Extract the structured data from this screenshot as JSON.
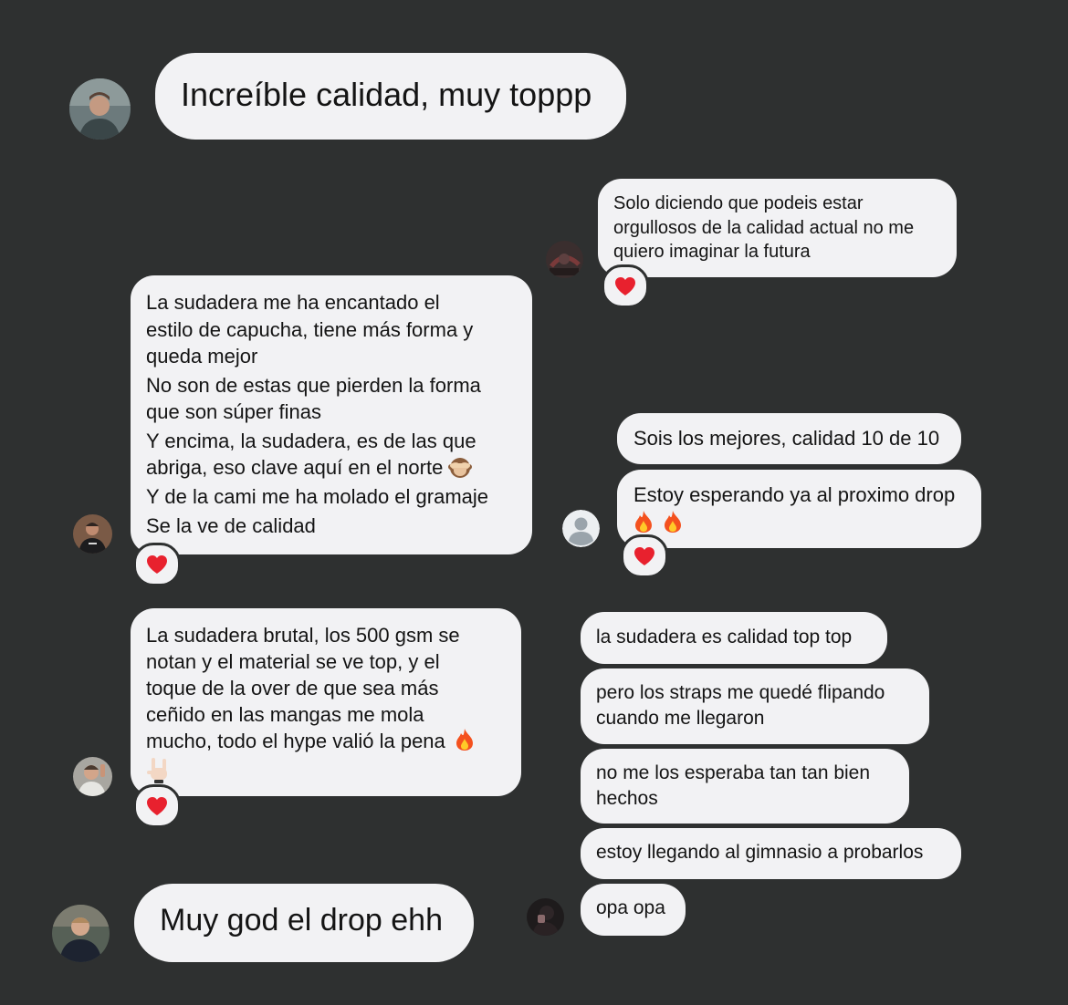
{
  "messages": {
    "m1": {
      "text": "Increíble calidad, muy toppp"
    },
    "m2": {
      "text": "Solo diciendo que podeis estar\norgullosos de la calidad actual no me\nquiero imaginar la futura"
    },
    "m3": {
      "lines": [
        "La sudadera me ha encantado el\nestilo de capucha, tiene más forma y\nqueda mejor",
        "No son de estas que pierden la forma\nque son súper finas",
        "Y encima, la sudadera, es de las que\nabriga, eso clave aquí en el norte",
        "Y de la cami me ha molado el gramaje",
        "Se la ve de calidad"
      ]
    },
    "m4": {
      "text": "Sois los mejores, calidad 10 de 10"
    },
    "m5": {
      "text": "Estoy esperando ya al proximo drop"
    },
    "m6": {
      "text": "La sudadera brutal, los 500 gsm se\nnotan y el material se ve top, y el\ntoque de la over de que sea más\nceñido en las mangas me mola\nmucho, todo el hype valió la pena"
    },
    "m7": {
      "text": "la sudadera es calidad top top"
    },
    "m8": {
      "text": "pero los straps me quedé flipando\ncuando me llegaron"
    },
    "m9": {
      "text": "no me los esperaba tan tan bien\nhechos"
    },
    "m10": {
      "text": "estoy llegando al gimnasio a probarlos"
    },
    "m11": {
      "text": "opa opa"
    },
    "m12": {
      "text": "Muy god el drop ehh"
    }
  },
  "reactions": {
    "icon": "red-heart-icon",
    "color": "#e8212e"
  },
  "emoji": {
    "fire": "fire-icon",
    "see_no_evil": "see-no-evil-monkey-icon",
    "horns": "sign-of-the-horns-icon"
  },
  "colors": {
    "background": "#2e3030",
    "bubble": "#f2f2f4",
    "text": "#141414"
  }
}
